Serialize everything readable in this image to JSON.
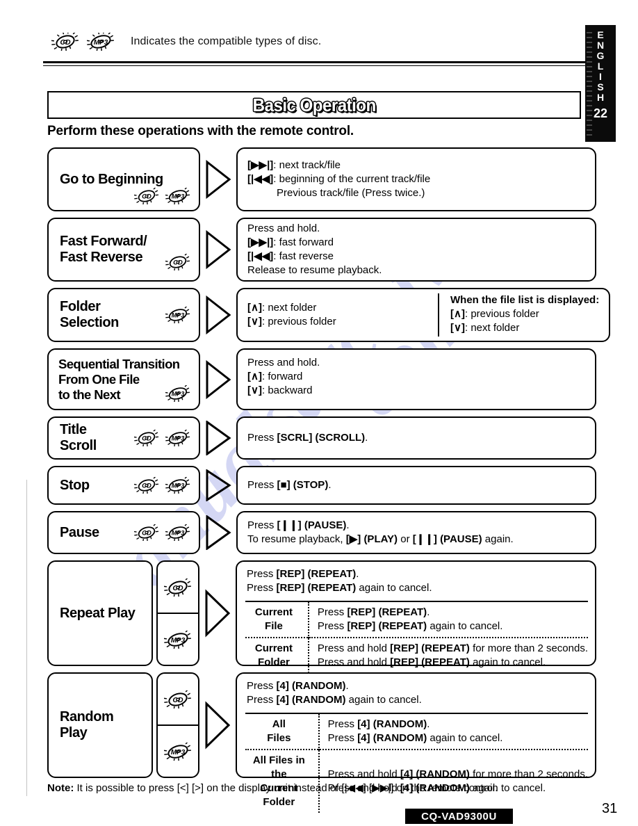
{
  "legend": {
    "discs": [
      "CD",
      "MP3"
    ],
    "text": "Indicates the compatible types of disc."
  },
  "lang_tab": {
    "letters": [
      "E",
      "N",
      "G",
      "L",
      "I",
      "S",
      "H"
    ],
    "page_marker": "22"
  },
  "section": {
    "title": "Basic Operation",
    "subhead": "Perform these operations with the remote control."
  },
  "rows": [
    {
      "label": "Go to Beginning",
      "discs": [
        "CD",
        "MP3"
      ],
      "lines": [
        "[▶▶|]: next track/file",
        "[|◀◀]: beginning of the current track/file",
        "Previous track/file (Press twice.)"
      ]
    },
    {
      "label": "Fast Forward/\nFast Reverse",
      "discs": [
        "CD"
      ],
      "lines": [
        "Press and hold.",
        "[▶▶|]: fast forward",
        "[|◀◀]: fast reverse",
        "Release to resume playback."
      ]
    },
    {
      "label": "Folder\nSelection",
      "discs": [
        "MP3"
      ],
      "left_lines": [
        "[∧]: next folder",
        "[∨]: previous folder"
      ],
      "right_heading": "When the file list is displayed:",
      "right_lines": [
        "[∧]: previous folder",
        "[∨]: next folder"
      ]
    },
    {
      "label": "Sequential Transition\nFrom One File\nto the Next",
      "discs": [
        "MP3"
      ],
      "lines": [
        "Press and hold.",
        "[∧]: forward",
        "[∨]: backward"
      ]
    },
    {
      "label": "Title\nScroll",
      "discs": [
        "CD",
        "MP3"
      ],
      "lines": [
        "Press [SCRL] (SCROLL)."
      ]
    },
    {
      "label": "Stop",
      "discs": [
        "CD",
        "MP3"
      ],
      "lines": [
        "Press [■] (STOP)."
      ]
    },
    {
      "label": "Pause",
      "discs": [
        "CD",
        "MP3"
      ],
      "lines": [
        "Press [❙❙] (PAUSE).",
        "To resume playback, [▶] (PLAY) or [❙❙] (PAUSE) again."
      ]
    }
  ],
  "repeat_play": {
    "label": "Repeat Play",
    "discs": [
      "CD",
      "MP3"
    ],
    "top_lines": [
      "Press [REP] (REPEAT).",
      "Press [REP] (REPEAT) again to cancel."
    ],
    "table": [
      {
        "name": "Current\nFile",
        "lines": [
          "Press [REP] (REPEAT).",
          "Press [REP] (REPEAT) again to cancel."
        ]
      },
      {
        "name": "Current\nFolder",
        "lines": [
          "Press and hold [REP] (REPEAT) for more than 2 seconds.",
          "Press and hold [REP] (REPEAT) again to cancel."
        ]
      }
    ]
  },
  "random_play": {
    "label": "Random\nPlay",
    "discs": [
      "CD",
      "MP3"
    ],
    "top_lines": [
      "Press [4] (RANDOM).",
      "Press [4] (RANDOM) again to cancel."
    ],
    "table": [
      {
        "name": "All\nFiles",
        "lines": [
          "Press [4] (RANDOM).",
          "Press [4] (RANDOM) again to cancel."
        ]
      },
      {
        "name": "All Files in the\nCurrent Folder",
        "lines": [
          "Press and hold [4] (RANDOM) for more than 2 seconds.",
          "Press and hold [4] (RANDOM) again to cancel."
        ]
      }
    ]
  },
  "note": {
    "prefix": "Note:",
    "text": " It is possible to press [<] [>] on the display unit instead of [|◀◀] [▶▶|] on the remote control."
  },
  "footer": {
    "model": "CQ-VAD9300U",
    "page_number": "31"
  },
  "watermark": {
    "line1": "manualsarchive",
    "line2": ".com"
  },
  "colors": {
    "ink": "#000000",
    "paper": "#ffffff",
    "watermark": "#c9cdf2"
  }
}
